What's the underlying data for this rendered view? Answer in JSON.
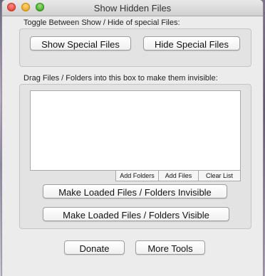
{
  "window": {
    "title": "Show Hidden Files"
  },
  "toggle_section": {
    "caption": "Toggle Between Show / Hide of special Files:",
    "show_label": "Show Special Files",
    "hide_label": "Hide Special Files"
  },
  "drop_section": {
    "caption": "Drag Files / Folders into this box to make them invisible:",
    "add_folders_label": "Add Folders",
    "add_files_label": "Add Files",
    "clear_list_label": "Clear List",
    "make_invisible_label": "Make Loaded Files / Folders Invisible",
    "make_visible_label": "Make Loaded Files / Folders Visible"
  },
  "footer": {
    "donate_label": "Donate",
    "more_tools_label": "More Tools"
  },
  "icons": {
    "close": "close-icon",
    "minimize": "minimize-icon",
    "zoom": "zoom-icon"
  },
  "colors": {
    "close": "#e0443a",
    "minimize": "#e8a320",
    "zoom": "#45a528",
    "window_bg": "#ececec"
  }
}
